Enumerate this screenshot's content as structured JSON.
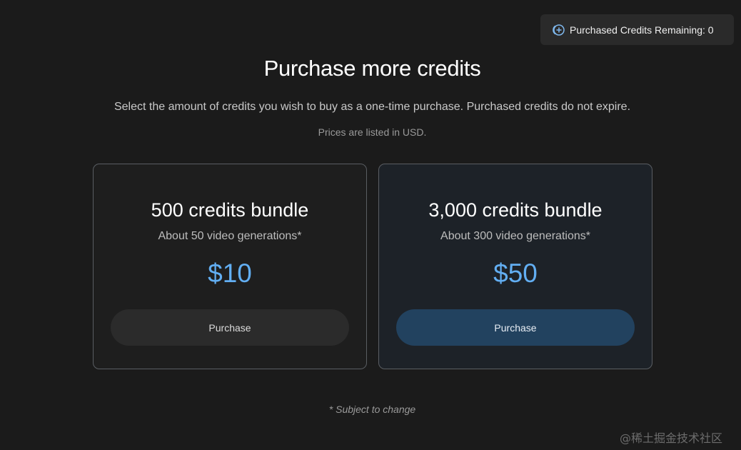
{
  "header": {
    "credits_remaining_label": "Purchased Credits Remaining: 0",
    "credits_icon": "coin-plus-icon"
  },
  "main": {
    "title": "Purchase more credits",
    "subtitle": "Select the amount of credits you wish to buy as a one-time purchase. Purchased credits do not expire.",
    "currency_note": "Prices are listed in USD.",
    "bundles": [
      {
        "name": "500 credits bundle",
        "description": "About 50 video generations*",
        "price": "$10",
        "button_label": "Purchase"
      },
      {
        "name": "3,000 credits bundle",
        "description": "About 300 video generations*",
        "price": "$50",
        "button_label": "Purchase"
      }
    ],
    "footnote": "* Subject to change"
  },
  "watermark": "@稀土掘金技术社区",
  "colors": {
    "background": "#1b1b1b",
    "accent_price": "#62aef2",
    "primary_button": "#22425f"
  }
}
